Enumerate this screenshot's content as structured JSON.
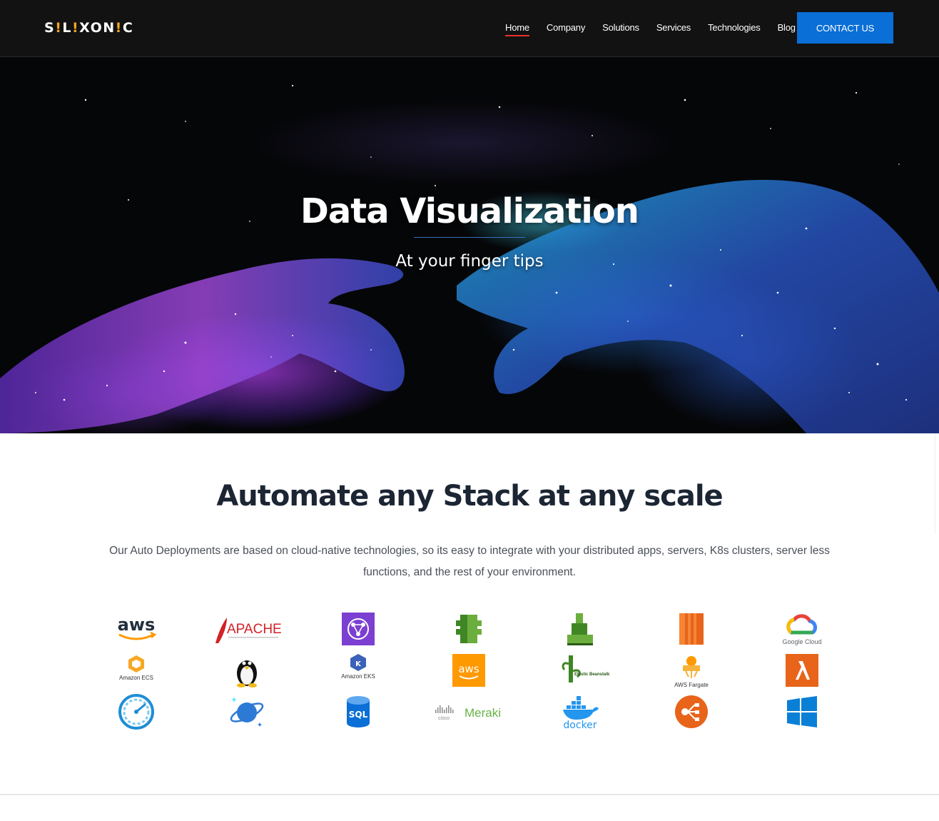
{
  "brand": {
    "logo_text_parts": [
      "S",
      "!",
      "L",
      "!",
      "XON",
      "!",
      "C"
    ]
  },
  "nav": {
    "items": [
      {
        "label": "Home",
        "active": true
      },
      {
        "label": "Company",
        "active": false
      },
      {
        "label": "Solutions",
        "active": false
      },
      {
        "label": "Services",
        "active": false
      },
      {
        "label": "Technologies",
        "active": false
      },
      {
        "label": "Blog",
        "active": false
      }
    ],
    "contact_label": "CONTACT US"
  },
  "hero": {
    "title": "Data Visualization",
    "subtitle": "At your finger tips"
  },
  "stack": {
    "title": "Automate any Stack at any scale",
    "description": "Our Auto Deployments are based on cloud-native technologies, so its easy to integrate with your distributed apps, servers, K8s clusters, server less functions, and the rest of your environment.",
    "logos": [
      {
        "name": "aws-logo",
        "text": "aws"
      },
      {
        "name": "apache-logo",
        "text": "APACHE"
      },
      {
        "name": "aws-app-mesh-icon",
        "text": ""
      },
      {
        "name": "aws-code-icon",
        "text": ""
      },
      {
        "name": "aws-elastic-container-icon",
        "text": ""
      },
      {
        "name": "aws-ec2-icon",
        "text": ""
      },
      {
        "name": "google-cloud-logo",
        "text": "Google Cloud"
      },
      {
        "name": "amazon-ecs-logo",
        "text": "Amazon ECS"
      },
      {
        "name": "linux-tux-icon",
        "text": ""
      },
      {
        "name": "amazon-eks-logo",
        "text": "Amazon EKS"
      },
      {
        "name": "aws-badge-icon",
        "text": "aws"
      },
      {
        "name": "elastic-beanstalk-icon",
        "text": "Elastic Beanstalk"
      },
      {
        "name": "aws-fargate-logo",
        "text": "AWS Fargate"
      },
      {
        "name": "aws-lambda-icon",
        "text": ""
      },
      {
        "name": "speedometer-icon",
        "text": ""
      },
      {
        "name": "cosmos-db-icon",
        "text": ""
      },
      {
        "name": "azure-sql-icon",
        "text": "SQL"
      },
      {
        "name": "cisco-meraki-logo",
        "text": "Meraki"
      },
      {
        "name": "docker-logo",
        "text": "docker"
      },
      {
        "name": "load-balancer-icon",
        "text": ""
      },
      {
        "name": "windows-logo",
        "text": ""
      }
    ]
  },
  "colors": {
    "header_bg": "#121212",
    "accent_blue": "#0a6fd6",
    "active_underline": "#e8312a",
    "title_text": "#1c2533",
    "body_text": "#4a4f58",
    "aws_orange": "#ff9900",
    "aws_green": "#3f8624"
  }
}
